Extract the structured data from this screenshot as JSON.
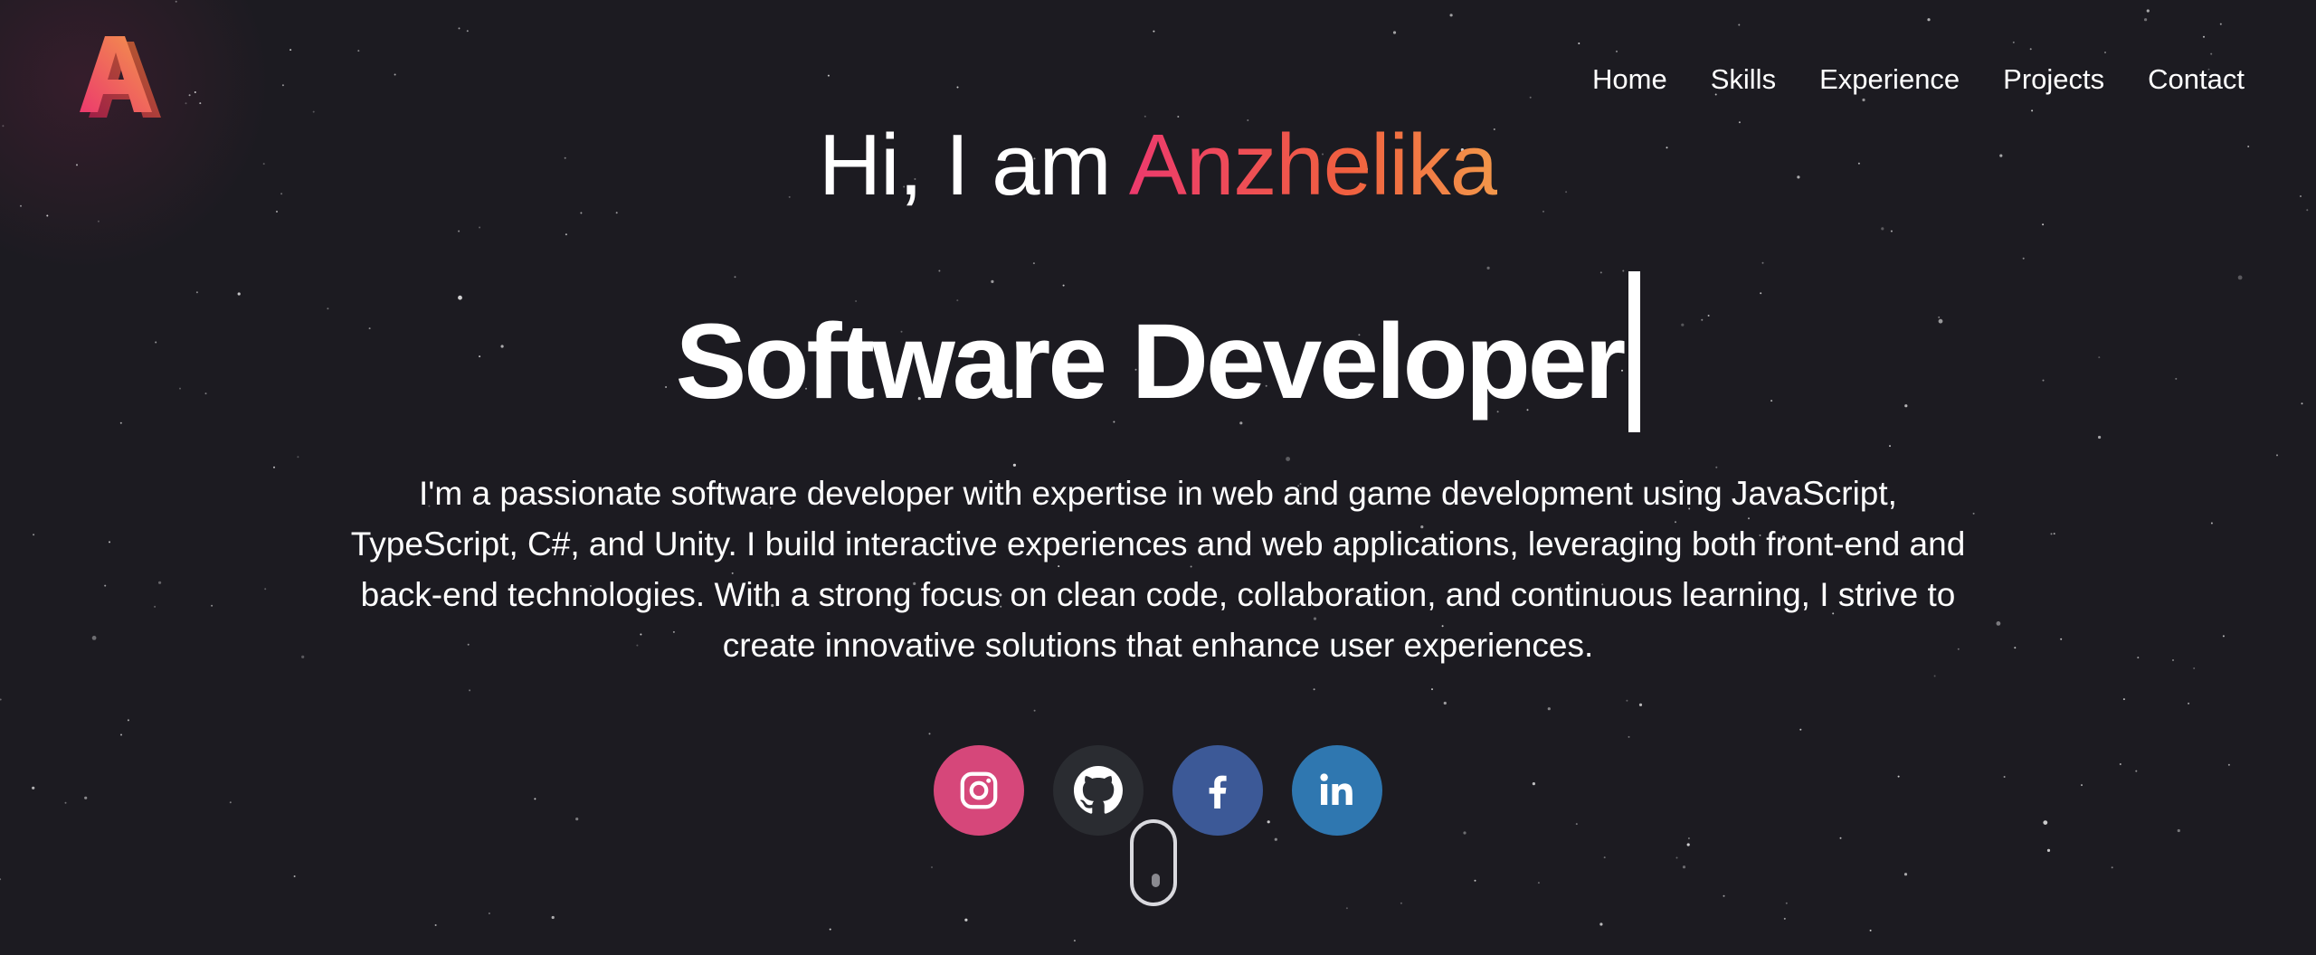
{
  "logo": {
    "letter": "A",
    "icon": "letter-a-logo-icon"
  },
  "nav": {
    "items": [
      {
        "label": "Home"
      },
      {
        "label": "Skills"
      },
      {
        "label": "Experience"
      },
      {
        "label": "Projects"
      },
      {
        "label": "Contact"
      }
    ]
  },
  "hero": {
    "greeting_prefix": "Hi, I am ",
    "name": "Anzhelika",
    "role": "Software Developer",
    "bio": "I'm a passionate software developer with expertise in web and game development using JavaScript, TypeScript, C#, and Unity. I build interactive experiences and web applications, leveraging both front-end and back-end technologies. With a strong focus on clean code, collaboration, and continuous learning, I strive to create innovative solutions that enhance user experiences."
  },
  "socials": [
    {
      "icon": "instagram-icon",
      "color": "#d6477a"
    },
    {
      "icon": "github-icon",
      "color": "#2a2c31"
    },
    {
      "icon": "facebook-icon",
      "color": "#3c5997"
    },
    {
      "icon": "linkedin-icon",
      "color": "#2f77b0"
    }
  ],
  "colors": {
    "background": "#1c1b21",
    "accent_start": "#ec3a6d",
    "accent_end": "#f3974a",
    "text": "#ffffff"
  },
  "scroll_indicator": {
    "icon": "mouse-scroll-icon"
  }
}
